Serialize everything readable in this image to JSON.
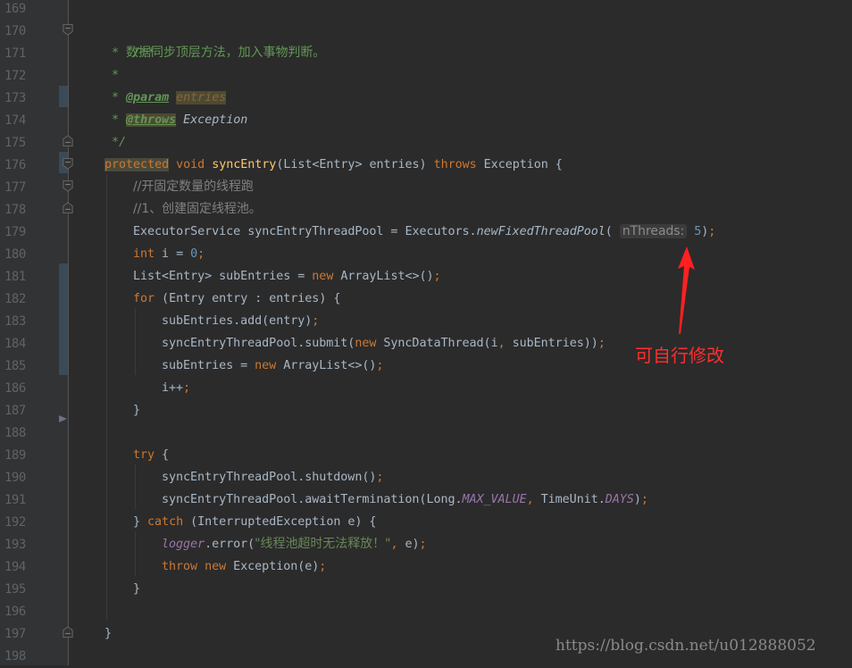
{
  "editor": {
    "line_numbers": [
      "169",
      "170",
      "171",
      "172",
      "173",
      "174",
      "175",
      "176",
      "177",
      "178",
      "179",
      "180",
      "181",
      "182",
      "183",
      "184",
      "185",
      "186",
      "187",
      "188",
      "189",
      "190",
      "191",
      "192",
      "193",
      "194",
      "195",
      "196",
      "197",
      "198"
    ],
    "code": {
      "l170": "/**",
      "l171_star": " * ",
      "l171_text": "数据同步顶层方法，加入事物判断。",
      "l172": " *",
      "l173_star": " * ",
      "l173_tag": "@param",
      "l173_val": "entries",
      "l174_star": " * ",
      "l174_tag": "@throws",
      "l174_ref": "Exception",
      "l175": " */",
      "l176_kw1": "protected",
      "l176_kw2": "void",
      "l176_fn": "syncEntry",
      "l176_params": "(List<Entry> entries) ",
      "l176_kw3": "throws",
      "l176_rest": " Exception {",
      "l177": "//开固定数量的线程跑",
      "l178": "//1、创建固定线程池。",
      "l179_a": "ExecutorService syncEntryThreadPool = Executors.",
      "l179_fn": "newFixedThreadPool",
      "l179_open": "(",
      "l179_hint": "nThreads:",
      "l179_num": "5",
      "l179_close": ")",
      "l180_kw": "int",
      "l180_a": " i = ",
      "l180_num": "0",
      "l181_a": "List<Entry> subEntries = ",
      "l181_kw": "new",
      "l181_b": " ArrayList<>()",
      "l182_kw": "for",
      "l182_a": " (Entry entry : entries) {",
      "l183": "subEntries.add(entry)",
      "l184_a": "syncEntryThreadPool.submit(",
      "l184_kw": "new",
      "l184_b": " SyncDataThread(i",
      "l184_c": " subEntries))",
      "l185_a": "subEntries = ",
      "l185_kw": "new",
      "l185_b": " ArrayList<>()",
      "l186": "i++",
      "l187": "}",
      "l189_kw": "try",
      "l189_a": " {",
      "l190": "syncEntryThreadPool.shutdown()",
      "l191_a": "syncEntryThreadPool.awaitTermination(Long.",
      "l191_f1": "MAX_VALUE",
      "l191_b": " TimeUnit.",
      "l191_f2": "DAYS",
      "l191_c": ")",
      "l192_a": "} ",
      "l192_kw": "catch",
      "l192_b": " (InterruptedException e) {",
      "l193_field": "logger",
      "l193_a": ".error(",
      "l193_str": "\"线程池超时无法释放！\"",
      "l193_b": " e)",
      "l194_kw1": "throw",
      "l194_kw2": "new",
      "l194_a": " Exception(e)",
      "l195": "}",
      "l197": "}",
      "semicolon": ";",
      "comma": ","
    }
  },
  "annotation": {
    "text": "可自行修改",
    "color": "#ff2e2e"
  },
  "watermark": "https://blog.csdn.net/u012888052"
}
